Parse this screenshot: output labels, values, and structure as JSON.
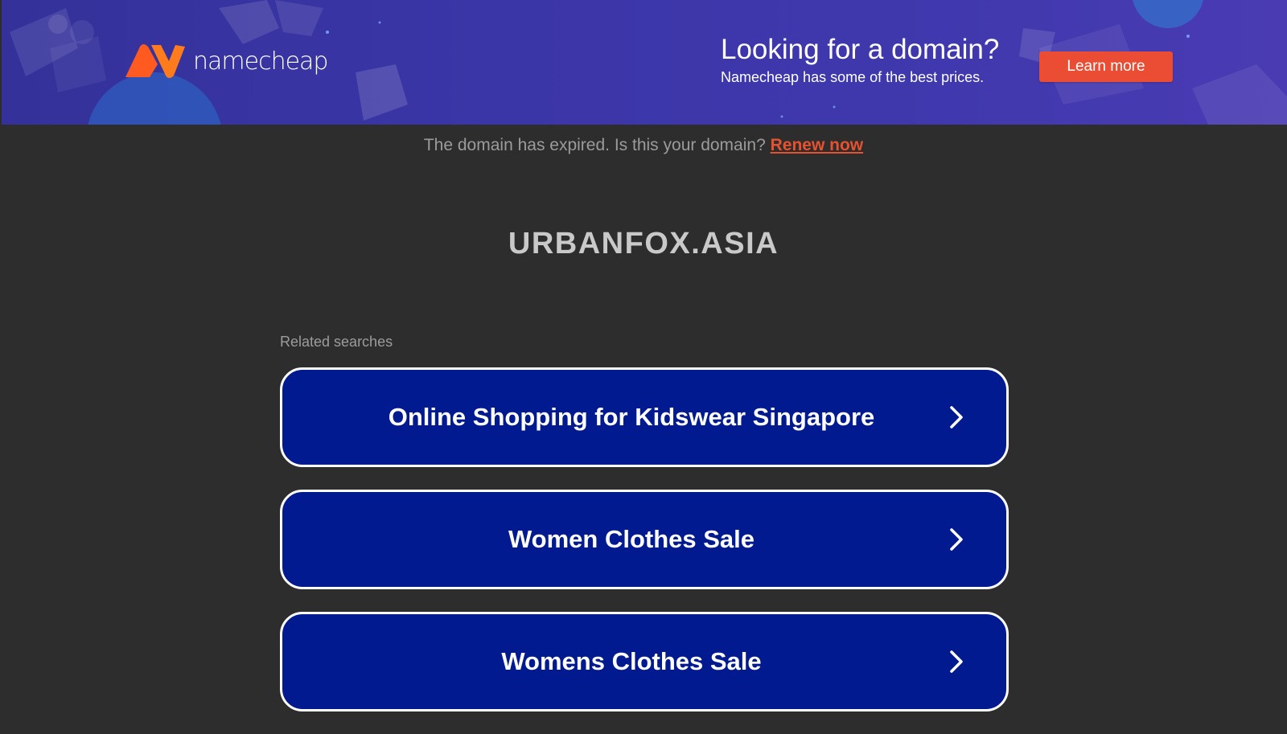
{
  "banner": {
    "logo_text": "namecheap",
    "title": "Looking for a domain?",
    "subtitle": "Namecheap has some of the best prices.",
    "button_label": "Learn more",
    "colors": {
      "background": "#3b36a8",
      "button": "#ea4d34",
      "logo_orange": "#ff6a13"
    }
  },
  "notice": {
    "text": "The domain has expired. Is this your domain?",
    "link_label": "Renew now",
    "link_color": "#e8512f"
  },
  "domain": {
    "name": "URBANFOX.ASIA"
  },
  "related": {
    "label": "Related searches",
    "items": [
      {
        "label": "Online Shopping for Kidswear Singapore",
        "icon": "chevron-right-icon"
      },
      {
        "label": "Women Clothes Sale",
        "icon": "chevron-right-icon"
      },
      {
        "label": "Womens Clothes Sale",
        "icon": "chevron-right-icon"
      }
    ],
    "button_color": "#011a8f"
  }
}
